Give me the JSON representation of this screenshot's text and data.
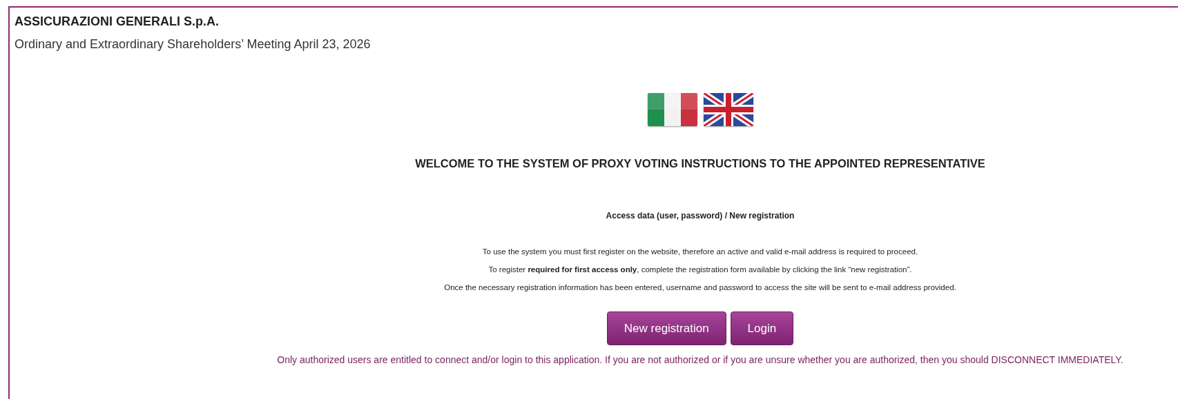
{
  "header": {
    "title": "ASSICURAZIONI GENERALI S.p.A.",
    "subtitle": "Ordinary and Extraordinary Shareholders’ Meeting April 23, 2026"
  },
  "languages": [
    {
      "kind": "italy"
    },
    {
      "kind": "uk"
    }
  ],
  "heading": "WELCOME TO THE SYSTEM OF PROXY VOTING INSTRUCTIONS TO THE APPOINTED REPRESENTATIVE",
  "access_title": "Access data (user, password) / New registration",
  "paragraphs": [
    "To use the system you must first register on the website, therefore an active and valid e-mail address is required to proceed.",
    "To register **required for first access only**, complete the registration form available by clicking the link “new registration”.",
    "Once the necessary registration information has been entered, username and password to access the site will be sent to e-mail address provided."
  ],
  "buttons": [
    "New registration",
    "Login"
  ],
  "warning": "Only authorized users are entitled to connect and/or login to this application. If you are not authorized or if you are unsure whether you are authorized, then you should DISCONNECT IMMEDIATELY."
}
